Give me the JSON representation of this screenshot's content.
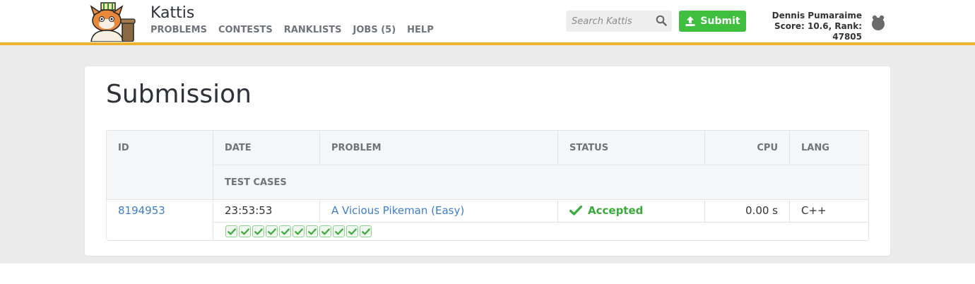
{
  "header": {
    "site_title": "Kattis",
    "nav": [
      {
        "label": "PROBLEMS"
      },
      {
        "label": "CONTESTS"
      },
      {
        "label": "RANKLISTS"
      },
      {
        "label": "JOBS (5)"
      },
      {
        "label": "HELP"
      }
    ],
    "search_placeholder": "Search Kattis",
    "submit_label": "Submit",
    "user_name": "Dennis Pumaraime",
    "user_stats": "Score: 10.6, Rank: 47805"
  },
  "page": {
    "title": "Submission"
  },
  "table": {
    "headers": {
      "id": "ID",
      "date": "DATE",
      "problem": "PROBLEM",
      "status": "STATUS",
      "cpu": "CPU",
      "lang": "LANG",
      "test_cases": "TEST CASES"
    },
    "row": {
      "id": "8194953",
      "date": "23:53:53",
      "problem": "A Vicious Pikeman (Easy)",
      "status": "Accepted",
      "cpu": "0.00 s",
      "lang": "C++",
      "test_cases_passed": 11
    }
  },
  "colors": {
    "accent_bar": "#f0b131",
    "submit_green": "#40bf3f",
    "accepted_green": "#3aaa3a",
    "link_blue": "#3d80c8"
  }
}
